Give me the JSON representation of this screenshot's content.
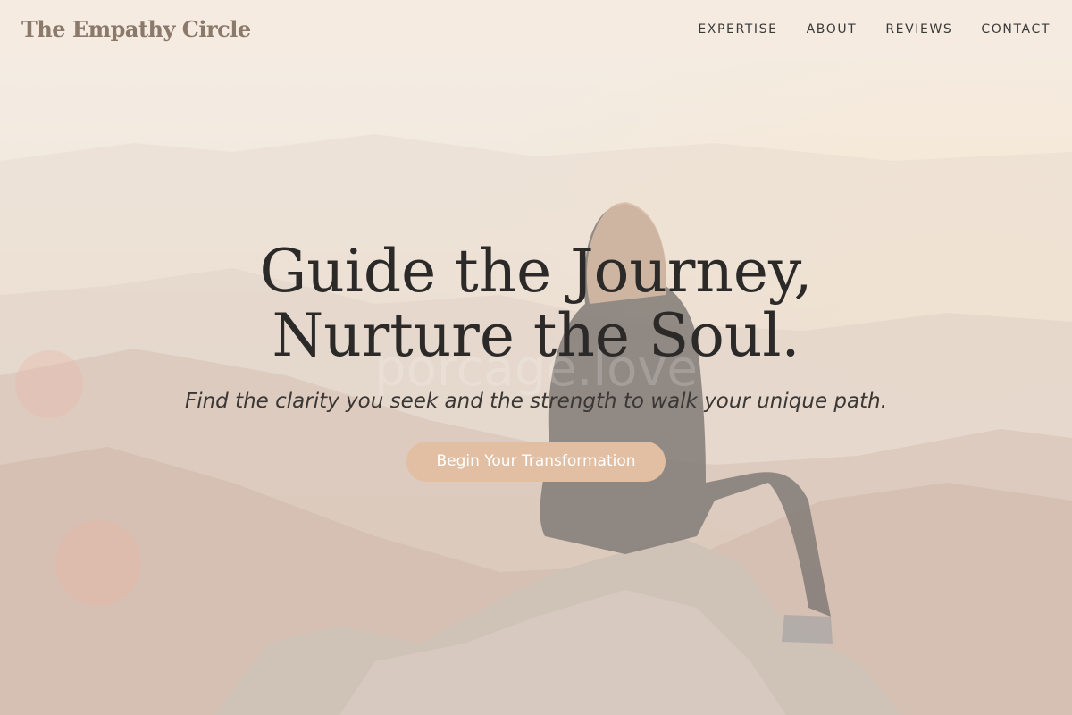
{
  "brand": {
    "name": "The Empathy Circle"
  },
  "nav": {
    "items": [
      {
        "label": "EXPERTISE"
      },
      {
        "label": "ABOUT"
      },
      {
        "label": "REVIEWS"
      },
      {
        "label": "CONTACT"
      }
    ]
  },
  "hero": {
    "headline_line1": "Guide the Journey,",
    "headline_line2": "Nurture the Soul.",
    "subheadline": "Find the clarity you seek and the strength to walk your unique path.",
    "cta_label": "Begin Your Transformation",
    "watermark": "porcage.love",
    "image_subject": "woman-sitting-on-mountain-rock"
  },
  "colors": {
    "header_bg": "#f4eae0",
    "brand_text": "#8b7a6b",
    "cta_bg": "#e2bfa3",
    "headline_text": "#2c2a29"
  }
}
